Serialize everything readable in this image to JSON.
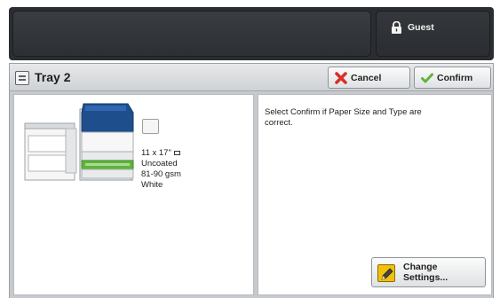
{
  "top_bar": {
    "user_label": "Guest",
    "user_icon": "lock-icon"
  },
  "header": {
    "title": "Tray 2",
    "title_icon": "tray-icon",
    "cancel_label": "Cancel",
    "cancel_icon": "red-x-icon",
    "confirm_label": "Confirm",
    "confirm_icon": "green-check-icon"
  },
  "machine": {
    "paper_size": "11 x 17\"",
    "paper_type": "Uncoated",
    "paper_weight": "81-90 gsm",
    "paper_color": "White"
  },
  "message": {
    "text": "Select Confirm if Paper Size and Type are correct."
  },
  "change_settings": {
    "line1": "Change",
    "line2": "Settings...",
    "icon": "pencil-icon"
  },
  "colors": {
    "accent_blue": "#1f4e8c",
    "accent_green": "#5fb43c",
    "cancel_red": "#d83127",
    "pencil_yellow": "#f1c20a"
  }
}
